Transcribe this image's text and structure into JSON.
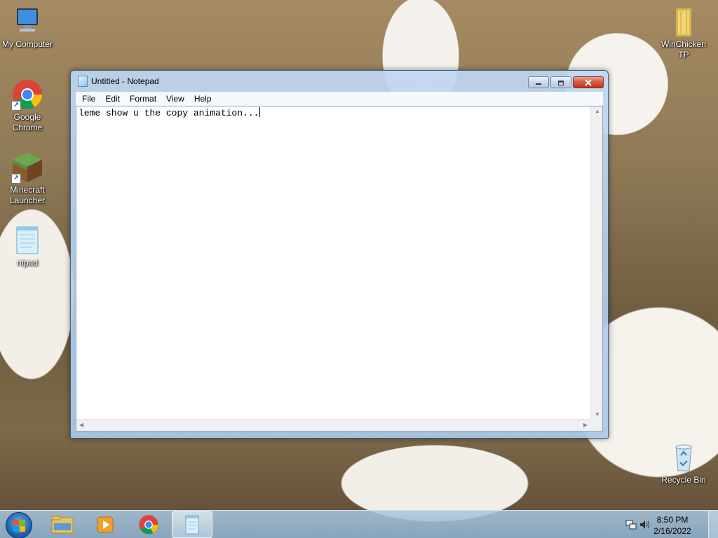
{
  "desktop": {
    "icons": [
      {
        "label": "My Computer",
        "icon": "computer-icon"
      },
      {
        "label": "Google Chrome",
        "icon": "chrome-icon"
      },
      {
        "label": "Minecraft Launcher",
        "icon": "minecraft-icon"
      },
      {
        "label": "ntpad",
        "icon": "notepad-icon"
      },
      {
        "label": "WinChicken TP",
        "icon": "folder-icon"
      },
      {
        "label": "Recycle Bin",
        "icon": "recycle-bin-icon"
      }
    ]
  },
  "window": {
    "title": "Untitled - Notepad",
    "menu": [
      "File",
      "Edit",
      "Format",
      "View",
      "Help"
    ],
    "content": "leme show u the copy animation...",
    "buttons": {
      "minimize": "minimize-icon",
      "maximize": "maximize-icon",
      "close": "close-icon"
    }
  },
  "taskbar": {
    "items": [
      "start-orb-icon",
      "file-explorer-icon",
      "media-player-icon",
      "chrome-icon",
      "notepad-icon"
    ],
    "active_item": "notepad-icon",
    "tray_icons": [
      "network-icon",
      "volume-icon"
    ],
    "clock": {
      "time": "8:50 PM",
      "date": "2/16/2022"
    }
  },
  "colors": {
    "window_frame": "#b9d3ec",
    "close_button": "#c9452c",
    "taskbar": "#9fbcd6"
  }
}
